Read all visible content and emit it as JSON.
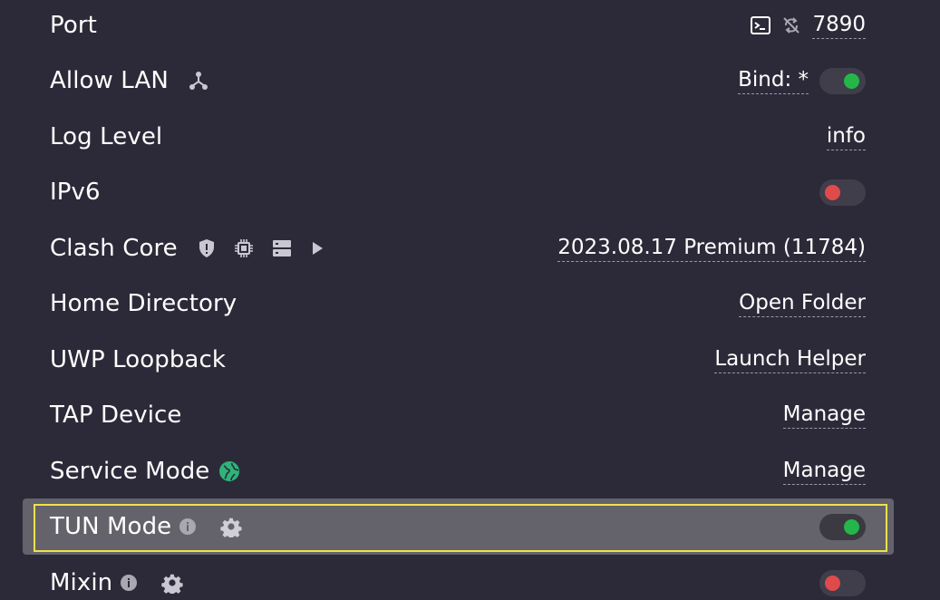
{
  "settings": {
    "port": {
      "label": "Port",
      "value": "7890"
    },
    "allow_lan": {
      "label": "Allow LAN",
      "bind": "Bind: *",
      "enabled": true
    },
    "log_level": {
      "label": "Log Level",
      "value": "info"
    },
    "ipv6": {
      "label": "IPv6",
      "enabled": false
    },
    "clash_core": {
      "label": "Clash Core",
      "version": "2023.08.17 Premium (11784)"
    },
    "home_directory": {
      "label": "Home Directory",
      "action": "Open Folder"
    },
    "uwp_loopback": {
      "label": "UWP Loopback",
      "action": "Launch Helper"
    },
    "tap_device": {
      "label": "TAP Device",
      "action": "Manage"
    },
    "service_mode": {
      "label": "Service Mode",
      "action": "Manage"
    },
    "tun_mode": {
      "label": "TUN Mode",
      "enabled": true
    },
    "mixin": {
      "label": "Mixin",
      "enabled": false
    }
  },
  "colors": {
    "background": "#2c2a38",
    "toggle_on": "#25b64a",
    "toggle_off": "#df4b4b",
    "highlight": "#f0e14a",
    "globe": "#2fb37a"
  },
  "icons": {
    "port": [
      "terminal-icon",
      "sync-disabled-icon"
    ],
    "allow_lan": [
      "network-icon"
    ],
    "clash_core": [
      "shield-alert-icon",
      "chip-icon",
      "server-icon",
      "play-icon"
    ],
    "service_mode": [
      "globe-icon"
    ],
    "tun_mode": [
      "info-icon",
      "gear-icon"
    ],
    "mixin": [
      "info-icon",
      "gear-icon"
    ]
  }
}
